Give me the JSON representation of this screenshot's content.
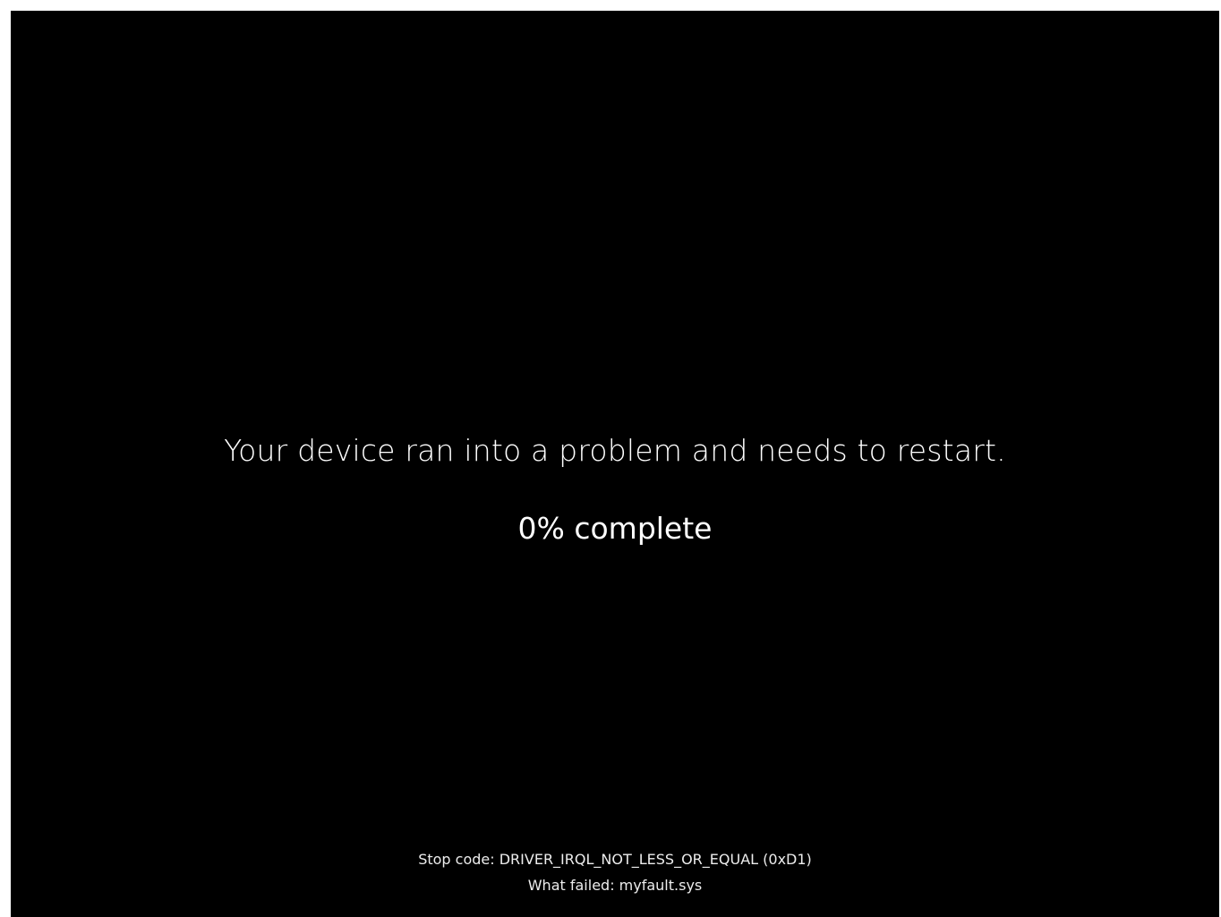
{
  "screen": {
    "message": "Your device ran into a problem and needs to restart.",
    "progress_text": "0% complete",
    "progress_percent": 0,
    "background_color": "#000000",
    "text_color": "#ffffff"
  },
  "details": {
    "stop_code": "Stop code: DRIVER_IRQL_NOT_LESS_OR_EQUAL (0xD1)",
    "what_failed": "What failed: myfault.sys"
  }
}
